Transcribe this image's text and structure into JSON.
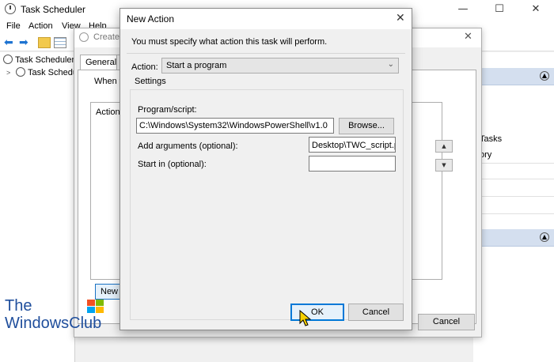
{
  "main_window": {
    "title": "Task Scheduler",
    "window_controls": {
      "minimize": "—",
      "maximize": "☐",
      "close": "✕"
    },
    "menu": [
      "File",
      "Action",
      "View",
      "Help"
    ],
    "tree": {
      "root": "Task Scheduler (L",
      "child": "Task Schedul"
    },
    "right_pane": {
      "items": [
        "Tasks",
        "ory"
      ]
    }
  },
  "create_task": {
    "title": "Create T",
    "tabs": [
      "General",
      "T"
    ],
    "when_text": "When yo",
    "action_column": "Action",
    "new_button": "New",
    "cancel_button": "Cancel"
  },
  "new_action": {
    "title": "New Action",
    "instruction": "You must specify what action this task will perform.",
    "action_label": "Action:",
    "action_value": "Start a program",
    "settings_label": "Settings",
    "program_label": "Program/script:",
    "program_value": "C:\\Windows\\System32\\WindowsPowerShell\\v1.0",
    "browse_button": "Browse...",
    "arguments_label": "Add arguments (optional):",
    "arguments_value": "Desktop\\TWC_script.ps1",
    "start_in_label": "Start in (optional):",
    "start_in_value": "",
    "ok_button": "OK",
    "cancel_button": "Cancel"
  },
  "watermark": {
    "line1": "The",
    "line2": "WindowsClub"
  }
}
